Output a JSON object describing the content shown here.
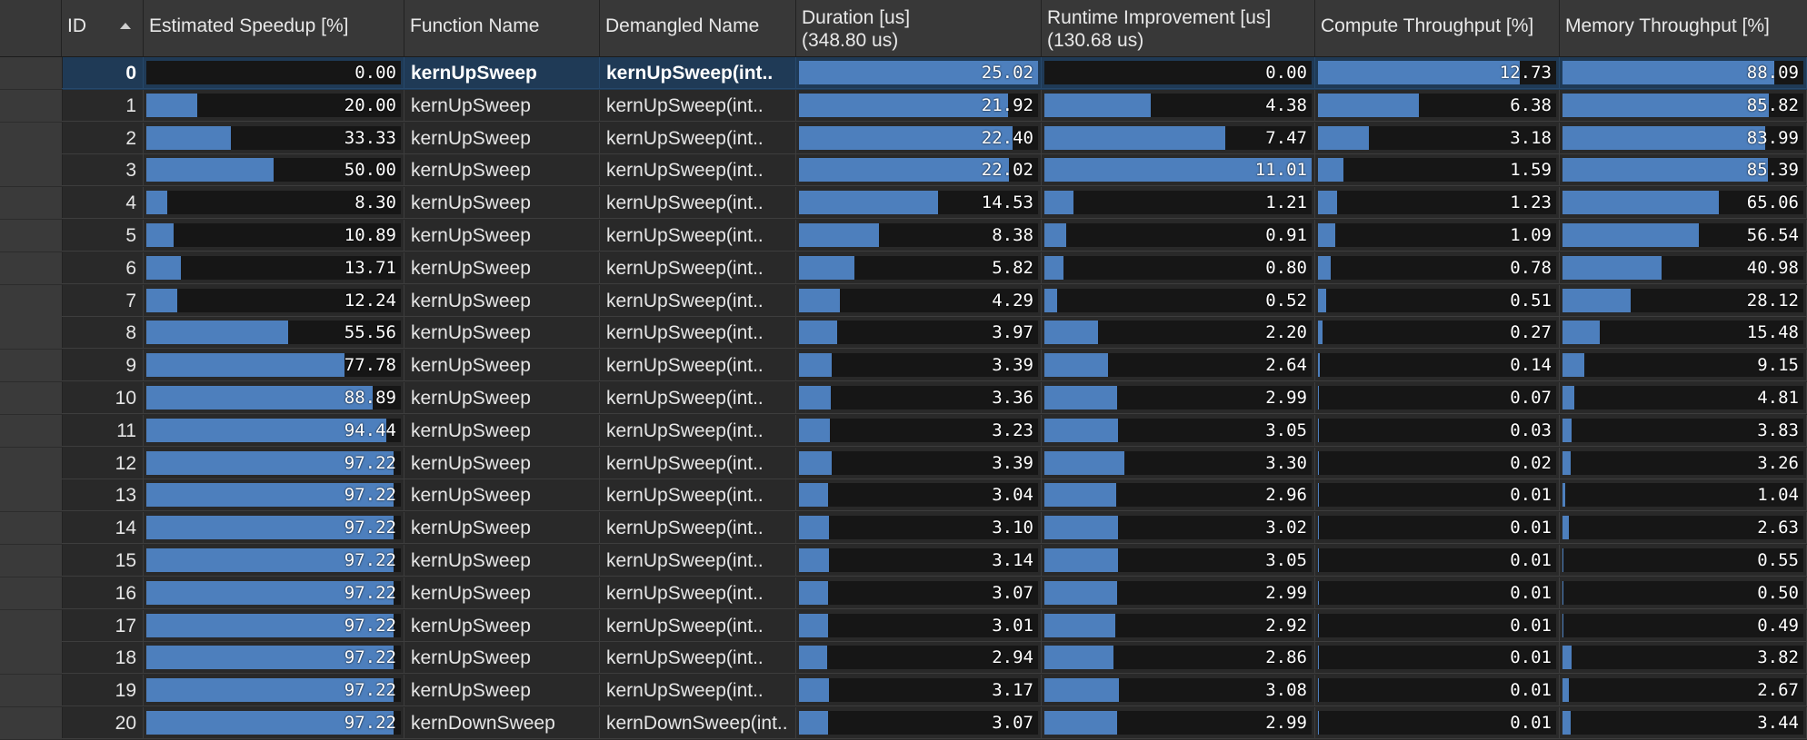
{
  "headers": {
    "id": "ID",
    "speedup": "Estimated Speedup [%]",
    "fname": "Function Name",
    "dname": "Demangled Name",
    "duration": "Duration [us]",
    "duration_total": "(348.80 us)",
    "runtime": "Runtime Improvement [us]",
    "runtime_total": "(130.68 us)",
    "compute": "Compute Throughput [%]",
    "memory": "Memory Throughput [%]"
  },
  "sort": {
    "column": "id",
    "direction": "ascending",
    "icon": "sort-ascending-icon"
  },
  "colors": {
    "bar_fill": "#4d7fbd",
    "selected_row": "#1f3a56",
    "background": "#262626"
  },
  "selected_row_index": 0,
  "scales": {
    "speedup_max": 100,
    "duration_max": 25.02,
    "runtime_max": 11.01,
    "compute_max": 15.0,
    "memory_max": 100
  },
  "rows": [
    {
      "id": "0",
      "speedup": "0.00",
      "fname": "kernUpSweep",
      "dname": "kernUpSweep(int..",
      "duration": "25.02",
      "runtime": "0.00",
      "compute": "12.73",
      "memory": "88.09"
    },
    {
      "id": "1",
      "speedup": "20.00",
      "fname": "kernUpSweep",
      "dname": "kernUpSweep(int..",
      "duration": "21.92",
      "runtime": "4.38",
      "compute": "6.38",
      "memory": "85.82"
    },
    {
      "id": "2",
      "speedup": "33.33",
      "fname": "kernUpSweep",
      "dname": "kernUpSweep(int..",
      "duration": "22.40",
      "runtime": "7.47",
      "compute": "3.18",
      "memory": "83.99"
    },
    {
      "id": "3",
      "speedup": "50.00",
      "fname": "kernUpSweep",
      "dname": "kernUpSweep(int..",
      "duration": "22.02",
      "runtime": "11.01",
      "compute": "1.59",
      "memory": "85.39"
    },
    {
      "id": "4",
      "speedup": "8.30",
      "fname": "kernUpSweep",
      "dname": "kernUpSweep(int..",
      "duration": "14.53",
      "runtime": "1.21",
      "compute": "1.23",
      "memory": "65.06"
    },
    {
      "id": "5",
      "speedup": "10.89",
      "fname": "kernUpSweep",
      "dname": "kernUpSweep(int..",
      "duration": "8.38",
      "runtime": "0.91",
      "compute": "1.09",
      "memory": "56.54"
    },
    {
      "id": "6",
      "speedup": "13.71",
      "fname": "kernUpSweep",
      "dname": "kernUpSweep(int..",
      "duration": "5.82",
      "runtime": "0.80",
      "compute": "0.78",
      "memory": "40.98"
    },
    {
      "id": "7",
      "speedup": "12.24",
      "fname": "kernUpSweep",
      "dname": "kernUpSweep(int..",
      "duration": "4.29",
      "runtime": "0.52",
      "compute": "0.51",
      "memory": "28.12"
    },
    {
      "id": "8",
      "speedup": "55.56",
      "fname": "kernUpSweep",
      "dname": "kernUpSweep(int..",
      "duration": "3.97",
      "runtime": "2.20",
      "compute": "0.27",
      "memory": "15.48"
    },
    {
      "id": "9",
      "speedup": "77.78",
      "fname": "kernUpSweep",
      "dname": "kernUpSweep(int..",
      "duration": "3.39",
      "runtime": "2.64",
      "compute": "0.14",
      "memory": "9.15"
    },
    {
      "id": "10",
      "speedup": "88.89",
      "fname": "kernUpSweep",
      "dname": "kernUpSweep(int..",
      "duration": "3.36",
      "runtime": "2.99",
      "compute": "0.07",
      "memory": "4.81"
    },
    {
      "id": "11",
      "speedup": "94.44",
      "fname": "kernUpSweep",
      "dname": "kernUpSweep(int..",
      "duration": "3.23",
      "runtime": "3.05",
      "compute": "0.03",
      "memory": "3.83"
    },
    {
      "id": "12",
      "speedup": "97.22",
      "fname": "kernUpSweep",
      "dname": "kernUpSweep(int..",
      "duration": "3.39",
      "runtime": "3.30",
      "compute": "0.02",
      "memory": "3.26"
    },
    {
      "id": "13",
      "speedup": "97.22",
      "fname": "kernUpSweep",
      "dname": "kernUpSweep(int..",
      "duration": "3.04",
      "runtime": "2.96",
      "compute": "0.01",
      "memory": "1.04"
    },
    {
      "id": "14",
      "speedup": "97.22",
      "fname": "kernUpSweep",
      "dname": "kernUpSweep(int..",
      "duration": "3.10",
      "runtime": "3.02",
      "compute": "0.01",
      "memory": "2.63"
    },
    {
      "id": "15",
      "speedup": "97.22",
      "fname": "kernUpSweep",
      "dname": "kernUpSweep(int..",
      "duration": "3.14",
      "runtime": "3.05",
      "compute": "0.01",
      "memory": "0.55"
    },
    {
      "id": "16",
      "speedup": "97.22",
      "fname": "kernUpSweep",
      "dname": "kernUpSweep(int..",
      "duration": "3.07",
      "runtime": "2.99",
      "compute": "0.01",
      "memory": "0.50"
    },
    {
      "id": "17",
      "speedup": "97.22",
      "fname": "kernUpSweep",
      "dname": "kernUpSweep(int..",
      "duration": "3.01",
      "runtime": "2.92",
      "compute": "0.01",
      "memory": "0.49"
    },
    {
      "id": "18",
      "speedup": "97.22",
      "fname": "kernUpSweep",
      "dname": "kernUpSweep(int..",
      "duration": "2.94",
      "runtime": "2.86",
      "compute": "0.01",
      "memory": "3.82"
    },
    {
      "id": "19",
      "speedup": "97.22",
      "fname": "kernUpSweep",
      "dname": "kernUpSweep(int..",
      "duration": "3.17",
      "runtime": "3.08",
      "compute": "0.01",
      "memory": "2.67"
    },
    {
      "id": "20",
      "speedup": "97.22",
      "fname": "kernDownSweep",
      "dname": "kernDownSweep(int..",
      "duration": "3.07",
      "runtime": "2.99",
      "compute": "0.01",
      "memory": "3.44"
    }
  ]
}
